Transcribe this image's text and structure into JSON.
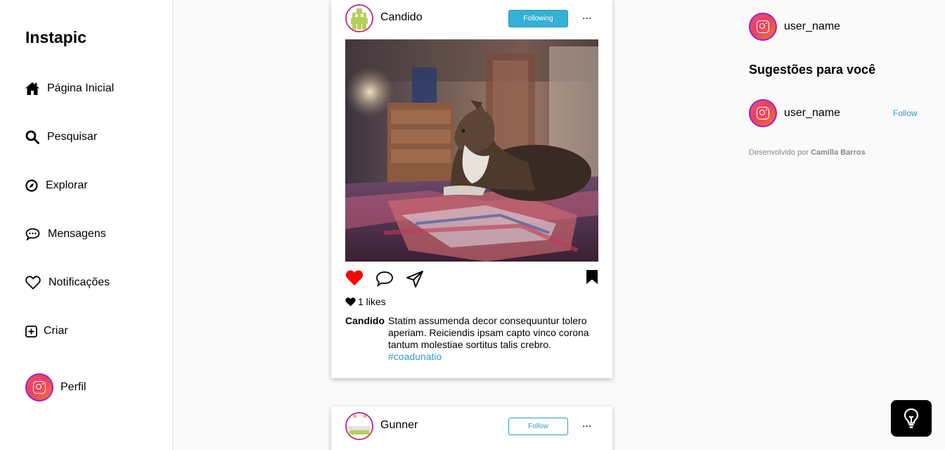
{
  "app": {
    "brand": "Instapic"
  },
  "sidebar": {
    "items": [
      {
        "label": "Página Inicial",
        "icon": "home-icon"
      },
      {
        "label": "Pesquisar",
        "icon": "search-icon"
      },
      {
        "label": "Explorar",
        "icon": "compass-icon"
      },
      {
        "label": "Mensagens",
        "icon": "chat-icon"
      },
      {
        "label": "Notificações",
        "icon": "heart-outline-icon"
      },
      {
        "label": "Criar",
        "icon": "plus-square-icon"
      },
      {
        "label": "Perfil",
        "icon": "instagram-avatar-icon"
      }
    ]
  },
  "posts": [
    {
      "username": "Candido",
      "follow_label": "Following",
      "more_label": "...",
      "likes_label": "1 likes",
      "caption_author": "Candido",
      "caption_text": "Statim assumenda decor consequuntur tolero aperiam. Reiciendis ipsam capto vinco corona tantum molestiae sortitus talis crebro.",
      "hashtag": "#coadunatio",
      "liked": true,
      "saved": true
    },
    {
      "username": "Gunner",
      "follow_label": "Follow",
      "more_label": "..."
    }
  ],
  "right_panel": {
    "current_user": "user_name",
    "suggestions_title": "Sugestões para você",
    "suggestions": [
      {
        "username": "user_name",
        "action": "Follow"
      }
    ],
    "credits_prefix": "Desenvolvido por",
    "credits_name": "Camilla Barros"
  },
  "colors": {
    "accent": "#35b0d6",
    "like_red": "#ff0000",
    "hashtag": "#2a9ec2"
  }
}
